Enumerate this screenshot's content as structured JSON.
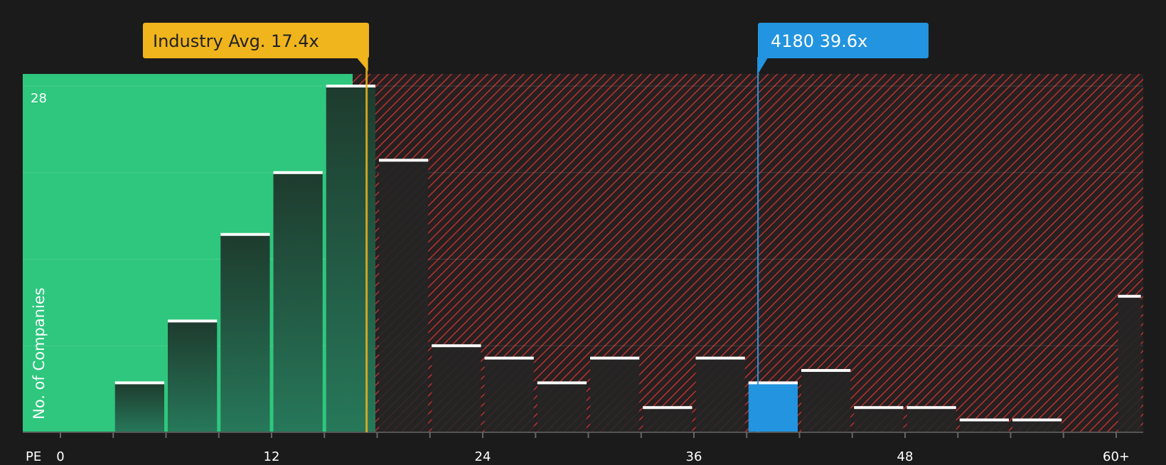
{
  "chart_data": {
    "type": "bar",
    "title": "",
    "xlabel": "PE",
    "ylabel": "No. of Companies",
    "x_axis_label": "PE",
    "y_axis_label": "No. of Companies",
    "ylim": [
      0,
      29
    ],
    "y_tick_label": "28",
    "y_tick_value": 28,
    "x_ticks": [
      {
        "value": 0,
        "label": "0"
      },
      {
        "value": 12,
        "label": "12"
      },
      {
        "value": 24,
        "label": "24"
      },
      {
        "value": 36,
        "label": "36"
      },
      {
        "value": 48,
        "label": "48"
      },
      {
        "value": 60,
        "label": "60+"
      }
    ],
    "bins": [
      {
        "start": 0,
        "end": 3,
        "count": 0
      },
      {
        "start": 3,
        "end": 6,
        "count": 4
      },
      {
        "start": 6,
        "end": 9,
        "count": 9
      },
      {
        "start": 9,
        "end": 12,
        "count": 16
      },
      {
        "start": 12,
        "end": 15,
        "count": 21
      },
      {
        "start": 15,
        "end": 18,
        "count": 28
      },
      {
        "start": 18,
        "end": 21,
        "count": 22
      },
      {
        "start": 21,
        "end": 24,
        "count": 7
      },
      {
        "start": 24,
        "end": 27,
        "count": 6
      },
      {
        "start": 27,
        "end": 30,
        "count": 4
      },
      {
        "start": 30,
        "end": 33,
        "count": 6
      },
      {
        "start": 33,
        "end": 36,
        "count": 2
      },
      {
        "start": 36,
        "end": 39,
        "count": 6
      },
      {
        "start": 39,
        "end": 42,
        "count": 4,
        "highlight": true
      },
      {
        "start": 42,
        "end": 45,
        "count": 5
      },
      {
        "start": 45,
        "end": 48,
        "count": 2
      },
      {
        "start": 48,
        "end": 51,
        "count": 2
      },
      {
        "start": 51,
        "end": 54,
        "count": 1
      },
      {
        "start": 54,
        "end": 57,
        "count": 1
      },
      {
        "start": 57,
        "end": 60,
        "count": 0
      },
      {
        "start": 60,
        "end": 61.5,
        "count": 11
      }
    ],
    "industry_avg": {
      "value": 17.4,
      "label": "Industry Avg. 17.4x",
      "color": "#f0b41c"
    },
    "company": {
      "value": 39.6,
      "label": "4180 39.6x",
      "color": "#2394df"
    },
    "colors": {
      "below_avg_bg": "#2ec77d",
      "above_avg_hatch": "#b83232",
      "bar_fill_top": "#1e3b2e",
      "bar_fill_bottom": "#27785a",
      "bar_cap": "#ffffff",
      "highlight": "#2394df"
    }
  }
}
